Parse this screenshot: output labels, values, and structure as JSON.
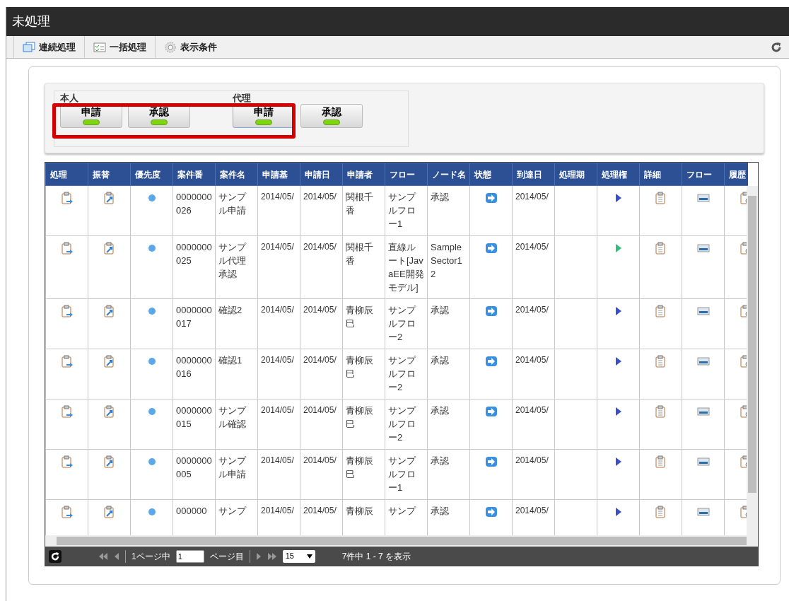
{
  "window": {
    "title": "未処理"
  },
  "toolbar": [
    {
      "label": "連続処理",
      "kind": "windows"
    },
    {
      "label": "一括処理",
      "kind": "checklist"
    },
    {
      "label": "表示条件",
      "kind": "gear"
    }
  ],
  "filter": {
    "highlight_box": true,
    "groups": [
      {
        "label": "本人",
        "buttons": [
          {
            "label": "申請",
            "selected": false
          },
          {
            "label": "承認",
            "selected": false
          }
        ]
      },
      {
        "label": "代理",
        "buttons": [
          {
            "label": "申請",
            "selected": true
          },
          {
            "label": "承認",
            "selected": false
          }
        ]
      }
    ]
  },
  "table": {
    "columns": [
      "処理",
      "振替",
      "優先度",
      "案件番",
      "案件名",
      "申請基",
      "申請日",
      "申請者",
      "フロー",
      "ノード名",
      "状態",
      "到達日",
      "処理期",
      "処理権",
      "詳細",
      "フロー",
      "履歴"
    ],
    "rows": [
      {
        "number": "0000000026",
        "name": "サンプル申請",
        "base_date": "2014/05/",
        "apply_date": "2014/05/",
        "applicant": "関根千香",
        "flow": "サンプルフロー1",
        "node": "承認",
        "arrival": "2014/05/",
        "color": "#3a4fc8"
      },
      {
        "number": "0000000025",
        "name": "サンプル代理承認",
        "base_date": "2014/05/",
        "apply_date": "2014/05/",
        "applicant": "関根千香",
        "flow": "直線ルート[JavaEE開発モデル]",
        "node": "Sample Sector12",
        "arrival": "2014/05/",
        "color": "#2fbf7a"
      },
      {
        "number": "0000000017",
        "name": "確認2",
        "base_date": "2014/05/",
        "apply_date": "2014/05/",
        "applicant": "青柳辰巳",
        "flow": "サンプルフロー2",
        "node": "承認",
        "arrival": "2014/05/",
        "color": "#3a4fc8"
      },
      {
        "number": "0000000016",
        "name": "確認1",
        "base_date": "2014/05/",
        "apply_date": "2014/05/",
        "applicant": "青柳辰巳",
        "flow": "サンプルフロー2",
        "node": "承認",
        "arrival": "2014/05/",
        "color": "#3a4fc8"
      },
      {
        "number": "0000000015",
        "name": "サンプル確認",
        "base_date": "2014/05/",
        "apply_date": "2014/05/",
        "applicant": "青柳辰巳",
        "flow": "サンプルフロー2",
        "node": "承認",
        "arrival": "2014/05/",
        "color": "#3a4fc8"
      },
      {
        "number": "0000000005",
        "name": "サンプル申請",
        "base_date": "2014/05/",
        "apply_date": "2014/05/",
        "applicant": "青柳辰巳",
        "flow": "サンプルフロー1",
        "node": "承認",
        "arrival": "2014/05/",
        "color": "#3a4fc8"
      },
      {
        "number": "000000",
        "name": "サンプ",
        "base_date": "2014/05/",
        "apply_date": "2014/05/",
        "applicant": "青柳辰",
        "flow": "サンプ",
        "node": "承認",
        "arrival": "2014/05/",
        "color": "#3a4fc8"
      }
    ]
  },
  "pager": {
    "page_of": "1ページ中",
    "page_value": "1",
    "page_suffix": "ページ目",
    "per_page": "15",
    "summary": "7件中 1 - 7 を表示"
  }
}
